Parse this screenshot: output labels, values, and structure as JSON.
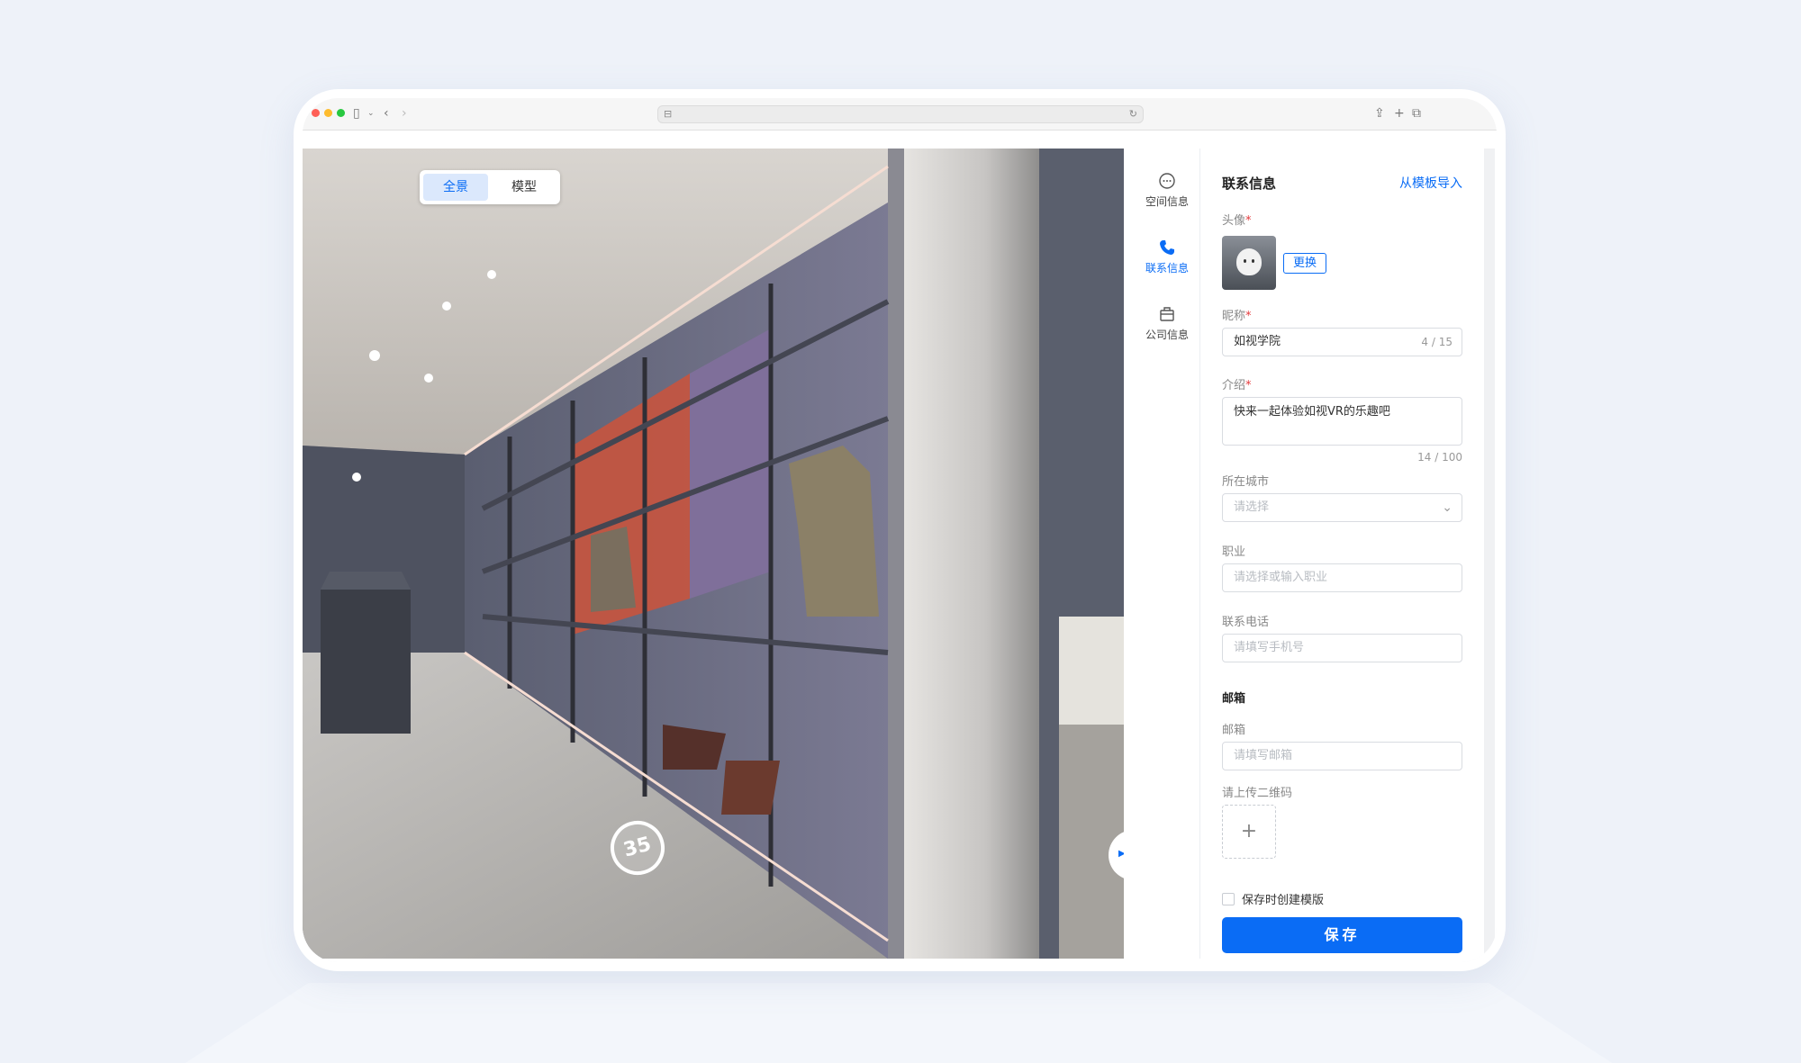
{
  "view_toggle": {
    "panorama": "全景",
    "model": "模型"
  },
  "pano_marker": "35",
  "sidebar": {
    "items": [
      {
        "label": "空间信息",
        "icon": "chat-dots-icon"
      },
      {
        "label": "联系信息",
        "icon": "phone-icon"
      },
      {
        "label": "公司信息",
        "icon": "building-icon"
      }
    ]
  },
  "panel": {
    "title": "联系信息",
    "import_link": "从模板导入",
    "avatar_label": "头像",
    "swap_button": "更换",
    "nickname": {
      "label": "昵称",
      "value": "如视学院",
      "count": "4 / 15"
    },
    "intro": {
      "label": "介绍",
      "value": "快来一起体验如视VR的乐趣吧",
      "count": "14 / 100"
    },
    "city": {
      "label": "所在城市",
      "placeholder": "请选择"
    },
    "job": {
      "label": "职业",
      "placeholder": "请选择或输入职业"
    },
    "phone": {
      "label": "联系电话",
      "placeholder": "请填写手机号"
    },
    "email_section": "邮箱",
    "email": {
      "label": "邮箱",
      "placeholder": "请填写邮箱"
    },
    "qr_label": "请上传二维码",
    "save_template": "保存时创建模版",
    "save_button": "保存"
  },
  "colors": {
    "accent": "#0a6cf5",
    "required": "#e4393c"
  }
}
